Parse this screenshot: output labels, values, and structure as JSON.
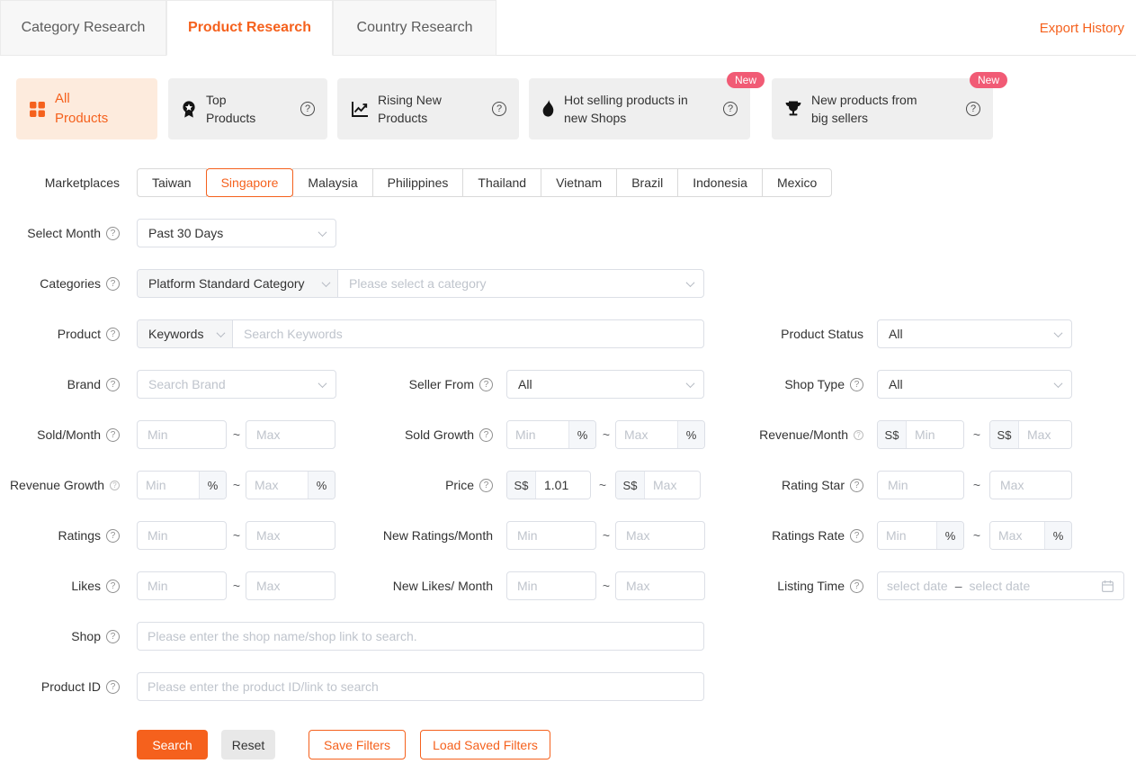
{
  "header": {
    "tabs": [
      {
        "label": "Category Research"
      },
      {
        "label": "Product Research"
      },
      {
        "label": "Country Research"
      }
    ],
    "export_link": "Export History"
  },
  "cards": {
    "all_products": "All Products",
    "top_products": "Top Products",
    "rising_new": "Rising New Products",
    "hot_new_shops": "Hot selling products in new Shops",
    "big_sellers": "New products from big sellers",
    "badge_new": "New"
  },
  "filters": {
    "tilde": "~",
    "marketplaces": {
      "label": "Marketplaces",
      "selected": "Singapore",
      "options": [
        "Taiwan",
        "Singapore",
        "Malaysia",
        "Philippines",
        "Thailand",
        "Vietnam",
        "Brazil",
        "Indonesia",
        "Mexico"
      ]
    },
    "select_month": {
      "label": "Select Month",
      "value": "Past 30 Days"
    },
    "categories": {
      "label": "Categories",
      "type_value": "Platform Standard Category",
      "placeholder": "Please select a category"
    },
    "product": {
      "label": "Product",
      "type_value": "Keywords",
      "placeholder": "Search Keywords"
    },
    "product_status": {
      "label": "Product Status",
      "value": "All"
    },
    "brand": {
      "label": "Brand",
      "placeholder": "Search Brand"
    },
    "seller_from": {
      "label": "Seller From",
      "value": "All"
    },
    "shop_type": {
      "label": "Shop Type",
      "value": "All"
    },
    "sold_month": {
      "label": "Sold/Month",
      "min": "Min",
      "max": "Max"
    },
    "sold_growth": {
      "label": "Sold Growth",
      "min": "Min",
      "max": "Max",
      "unit": "%"
    },
    "revenue_month": {
      "label": "Revenue/Month",
      "currency": "S$",
      "min": "Min",
      "max": "Max"
    },
    "revenue_growth": {
      "label": "Revenue Growth",
      "min": "Min",
      "max": "Max",
      "unit": "%"
    },
    "price": {
      "label": "Price",
      "currency": "S$",
      "min_value": "1.01",
      "max": "Max"
    },
    "rating_star": {
      "label": "Rating Star",
      "min": "Min",
      "max": "Max"
    },
    "ratings": {
      "label": "Ratings",
      "min": "Min",
      "max": "Max"
    },
    "new_ratings": {
      "label": "New Ratings/Month",
      "min": "Min",
      "max": "Max"
    },
    "ratings_rate": {
      "label": "Ratings Rate",
      "min": "Min",
      "max": "Max",
      "unit": "%"
    },
    "likes": {
      "label": "Likes",
      "min": "Min",
      "max": "Max"
    },
    "new_likes": {
      "label": "New Likes/ Month",
      "min": "Min",
      "max": "Max"
    },
    "listing_time": {
      "label": "Listing Time",
      "start_placeholder": "select date",
      "separator": "–",
      "end_placeholder": "select date"
    },
    "shop": {
      "label": "Shop",
      "placeholder": "Please enter the shop name/shop link to search."
    },
    "product_id": {
      "label": "Product ID",
      "placeholder": "Please enter the product ID/link to search"
    }
  },
  "actions": {
    "search": "Search",
    "reset": "Reset",
    "save_filters": "Save Filters",
    "load_saved_filters": "Load Saved Filters"
  },
  "colors": {
    "accent": "#f5611d",
    "badge": "#f15b75",
    "active_card_bg": "#fdebdd"
  }
}
